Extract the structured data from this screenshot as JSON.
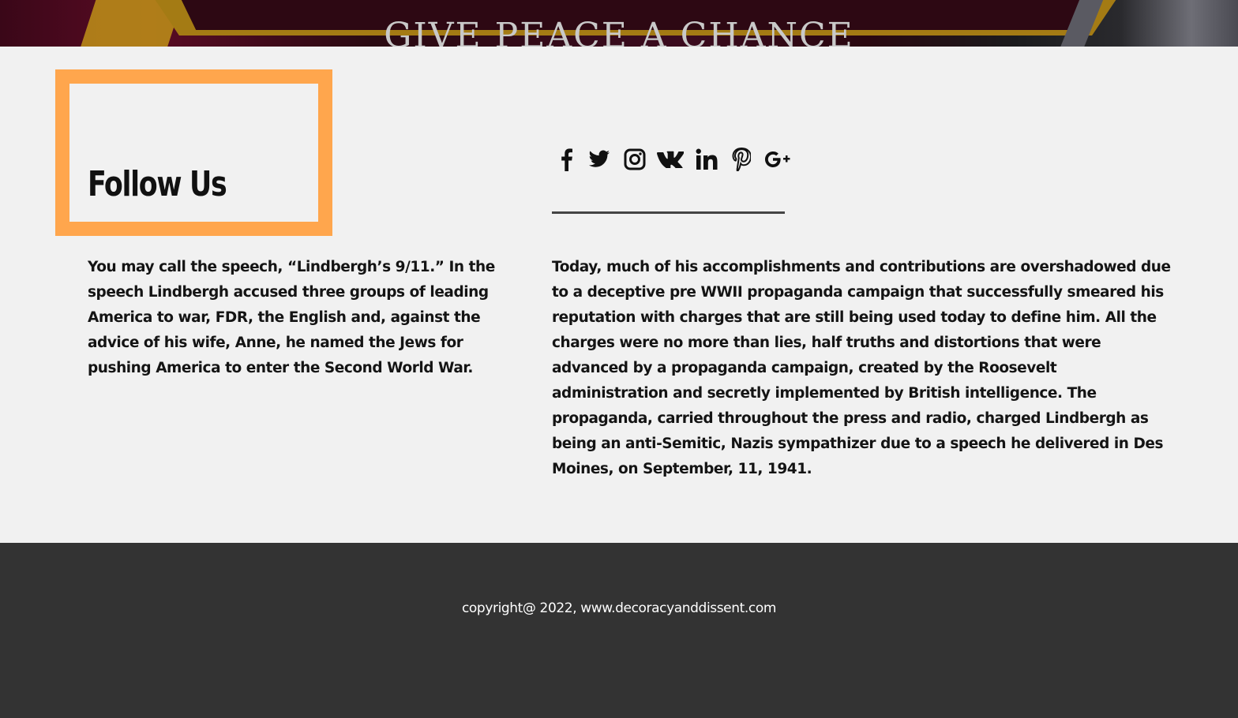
{
  "hero": {
    "slogan": "GIVE PEACE A CHANCE"
  },
  "follow": {
    "title": "Follow Us",
    "box_color": "#ffa64d"
  },
  "social": {
    "icons": [
      "facebook-icon",
      "twitter-icon",
      "instagram-icon",
      "vk-icon",
      "linkedin-icon",
      "pinterest-icon",
      "google-plus-icon"
    ]
  },
  "content": {
    "left_paragraph": "You may call the speech, “Lindbergh’s 9/11.” In the speech Lindbergh accused three groups of leading America to war, FDR, the English and, against the advice of his wife, Anne, he named  the Jews for pushing America to enter the Second World War.",
    "right_paragraph": "Today, much of his accomplishments and contributions are overshadowed due to a deceptive pre WWII propaganda campaign that successfully smeared his reputation with charges that are still being used today to define him. All the charges were no more than lies, half truths and distortions that were advanced by a propaganda campaign, created by the Roosevelt administration and secretly implemented by British intelligence. The propaganda, carried throughout the press and radio, charged Lindbergh as being an anti-Semitic, Nazis sympathizer due to a speech he delivered in Des Moines, on September, 11, 1941."
  },
  "footer": {
    "copyright": "copyright@ 2022, www.decoracyanddissent.com",
    "background": "#333333"
  }
}
